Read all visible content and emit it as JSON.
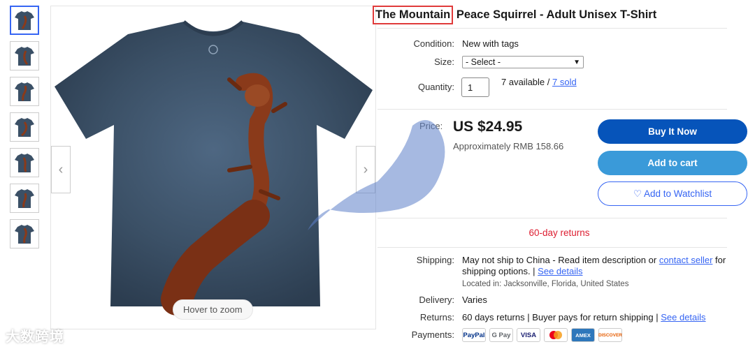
{
  "gallery": {
    "thumbnail_count": 7,
    "active_index": 0,
    "zoom_hint": "Hover to zoom"
  },
  "product": {
    "title_highlight": "The Mountain",
    "title_rest": " Peace Squirrel - Adult Unisex T-Shirt"
  },
  "details": {
    "condition_label": "Condition:",
    "condition_value": "New with tags",
    "size_label": "Size:",
    "size_value": "- Select -",
    "quantity_label": "Quantity:",
    "quantity_value": "1",
    "available": "7 available / ",
    "sold_link": "7 sold"
  },
  "price": {
    "label": "Price:",
    "value": "US $24.95",
    "approx": "Approximately RMB 158.66"
  },
  "actions": {
    "buy_now": "Buy It Now",
    "add_to_cart": "Add to cart",
    "watchlist": "♡ Add to Watchlist"
  },
  "returns_banner": "60-day returns",
  "shipping": {
    "label": "Shipping:",
    "text_before_link": "May not ship to China - Read item description or ",
    "contact_link": "contact seller",
    "text_after_link": " for shipping options. | ",
    "see_details": "See details",
    "location_label": "Located in: ",
    "location_value": "Jacksonville, Florida, United States"
  },
  "delivery": {
    "label": "Delivery:",
    "value": "Varies"
  },
  "returns": {
    "label": "Returns:",
    "value": "60 days returns | Buyer pays for return shipping | ",
    "see_details": "See details"
  },
  "payments": {
    "label": "Payments:",
    "methods": [
      "PayPal",
      "G Pay",
      "VISA",
      "Mastercard",
      "AMEX",
      "DISCOVER"
    ]
  },
  "watermark": "大数跨境",
  "colors": {
    "buy_now": "#0654ba",
    "add_to_cart": "#3a9ad9",
    "link": "#3665f3",
    "returns_red": "#dd1e31",
    "highlight_box": "#e03a3a",
    "shirt": "#3b5066"
  }
}
